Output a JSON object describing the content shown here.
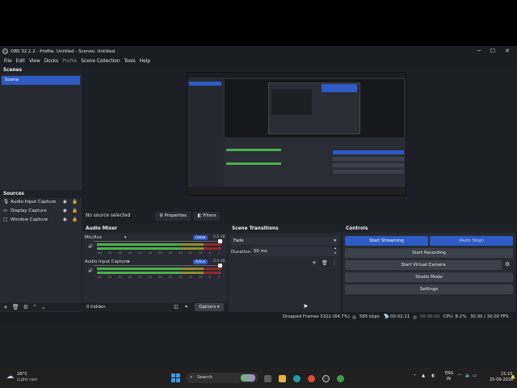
{
  "window": {
    "title": "OBS 32.1.2 - Profile: Untitled - Scenes: Untitled",
    "minimize": "─",
    "maximize": "☐",
    "close": "✕"
  },
  "menu": [
    "File",
    "Edit",
    "View",
    "Docks",
    "Profile",
    "Scene Collection",
    "Tools",
    "Help"
  ],
  "scenes": {
    "title": "Scenes",
    "items": [
      "Scene"
    ]
  },
  "sources": {
    "title": "Sources",
    "items": [
      "Audio Input Capture",
      "Display Capture",
      "Window Capture"
    ]
  },
  "context_bar": {
    "no_source": "No source selected",
    "properties": "Properties",
    "filters": "Filters"
  },
  "audio_mixer": {
    "title": "Audio Mixer",
    "channels": [
      {
        "name": "Mic/Aux",
        "badge": "Global",
        "db": "0.0 dB"
      },
      {
        "name": "Audio Input Capture",
        "badge": "Active",
        "db": "0.0 dB"
      }
    ],
    "ticks": [
      "-60",
      "-55",
      "-50",
      "-45",
      "-40",
      "-35",
      "-30",
      "-25",
      "-20",
      "-15",
      "-10",
      "-5",
      "0"
    ],
    "hidden": "0 hidden",
    "options": "Options"
  },
  "transitions": {
    "title": "Scene Transitions",
    "selected": "Fade",
    "duration_label": "Duration",
    "duration_value": "50 ms"
  },
  "controls": {
    "title": "Controls",
    "start_streaming": "Start Streaming",
    "auto_stop": "(Auto Stop)",
    "start_recording": "Start Recording",
    "start_virtual_camera": "Start Virtual Camera",
    "studio_mode": "Studio Mode",
    "settings": "Settings"
  },
  "status": {
    "dropped": "Dropped Frames 3322 (84.7%)",
    "bitrate": "585 kbps",
    "stream_time": "00:02:11",
    "rec_time": "00:00:00",
    "cpu": "CPU: 8.2%",
    "fps": "30.00 / 30.00 FPS"
  },
  "taskbar": {
    "weather_temp": "26°C",
    "weather_desc": "Light rain",
    "search": "Search",
    "lang_top": "ENG",
    "lang_bottom": "IN",
    "time": "15:10",
    "date": "25-09-2026"
  },
  "colors": {
    "accent": "#2f5bc4",
    "meter_green": "#4bb04b",
    "meter_yellow": "#8f8f2a",
    "meter_red": "#8c2b2b"
  }
}
